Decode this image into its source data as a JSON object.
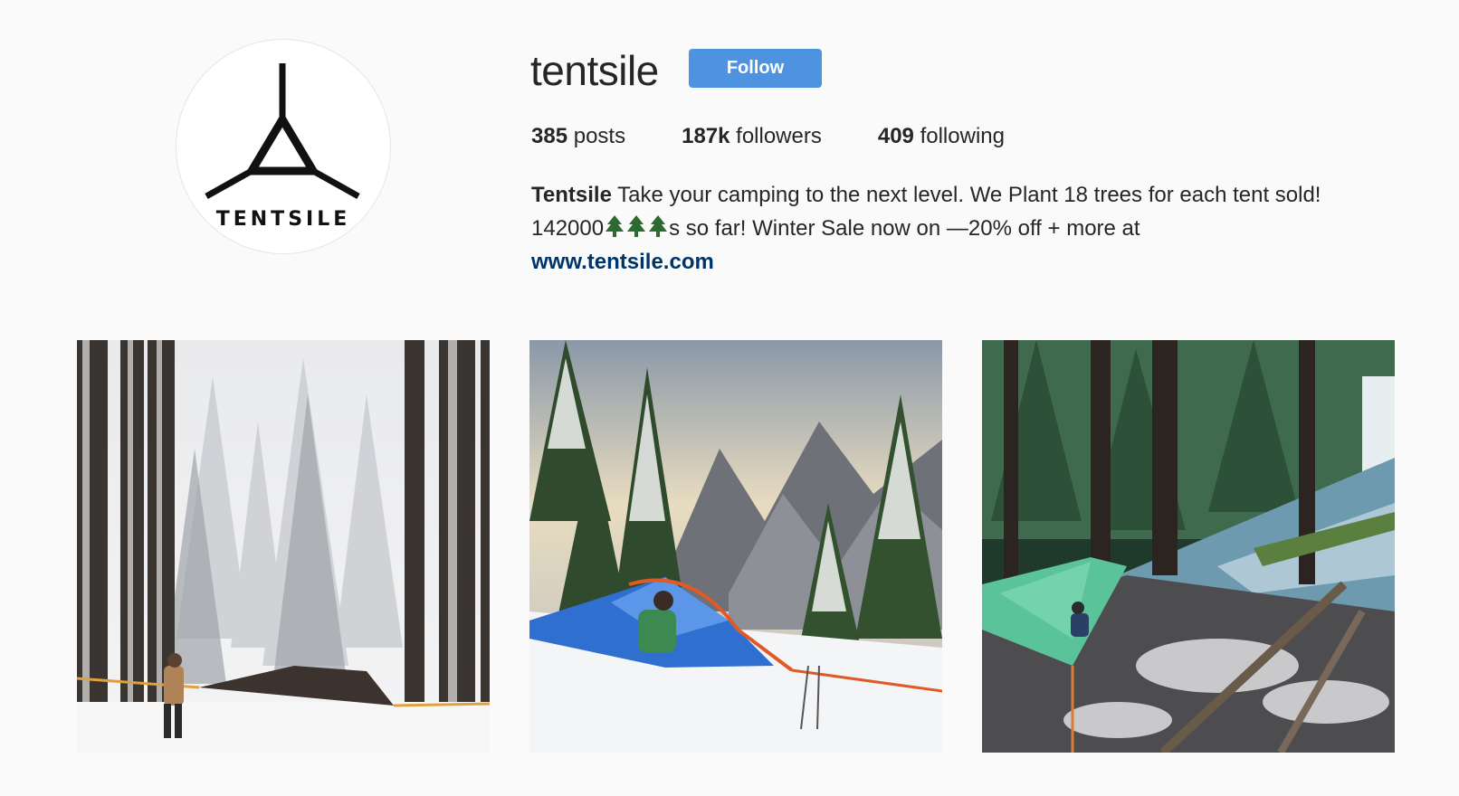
{
  "profile": {
    "username": "tentsile",
    "follow_label": "Follow",
    "avatar_wordmark": "TENTSILE",
    "stats": [
      {
        "count": "385",
        "label": "posts"
      },
      {
        "count": "187k",
        "label": "followers"
      },
      {
        "count": "409",
        "label": "following"
      }
    ],
    "bio": {
      "name": "Tentsile",
      "text_before_trees": " Take your camping to the next level. We Plant 18 trees for each tent sold! 142000",
      "tree_icons": [
        "evergreen-tree-icon",
        "evergreen-tree-icon",
        "evergreen-tree-icon"
      ],
      "text_after_trees": "s so far! Winter Sale now on —20% off + more at",
      "link": "www.tentsile.com"
    }
  },
  "posts": [
    {
      "scene": "snowy-forest-tent-setup"
    },
    {
      "scene": "mountain-snow-tent-view"
    },
    {
      "scene": "river-forest-green-tent"
    }
  ],
  "colors": {
    "background": "#fafafa",
    "follow_button": "#4e93e0",
    "link": "#003569",
    "text": "#262626"
  }
}
